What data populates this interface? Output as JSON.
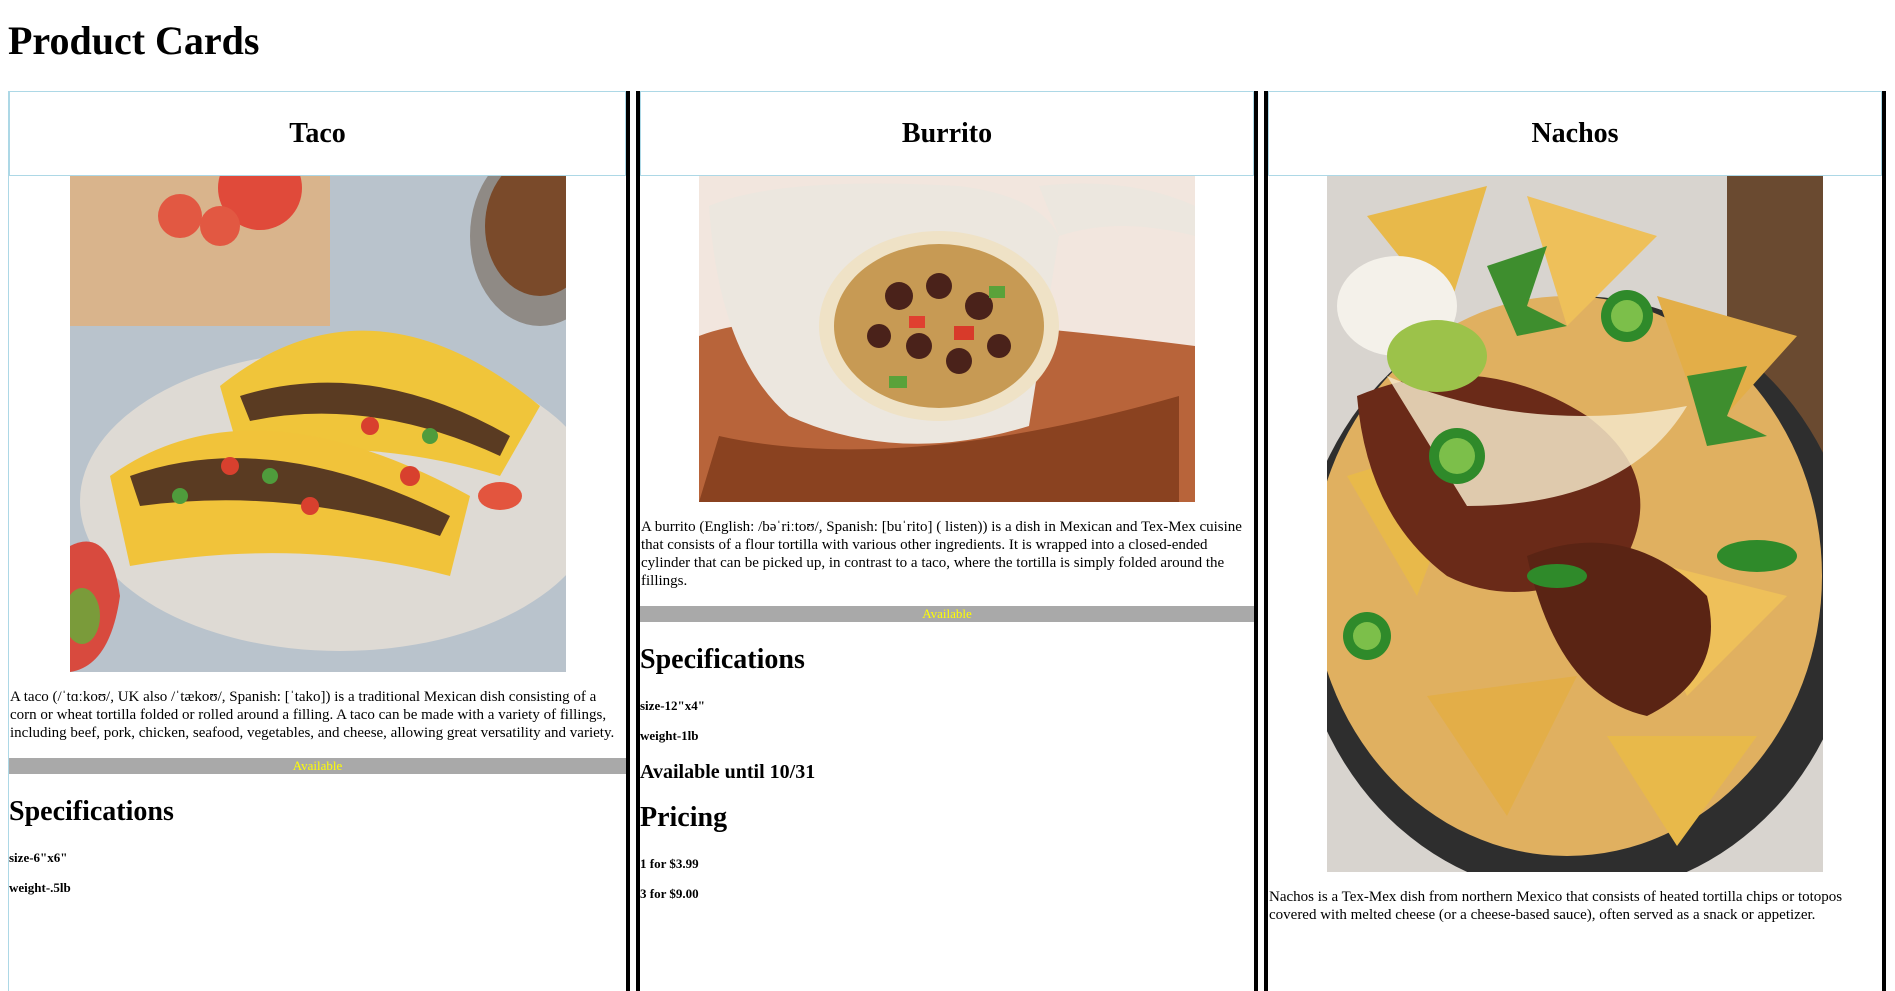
{
  "page": {
    "title": "Product Cards"
  },
  "colors": {
    "avail_bg": "#a9a9a9",
    "avail_text": "#ffff00",
    "card_border": "#add8e6"
  },
  "cards": [
    {
      "name": "Taco",
      "image": "taco-photo",
      "description": "A taco (/ˈtɑːkoʊ/, UK also /ˈtækoʊ/, Spanish: [ˈtako]) is a traditional Mexican dish consisting of a corn or wheat tortilla folded or rolled around a filling. A taco can be made with a variety of fillings, including beef, pork, chicken, seafood, vegetables, and cheese, allowing great versatility and variety.",
      "availability": "Available",
      "spec_title": "Specifications",
      "specs": [
        "size-6\"x6\"",
        "weight-.5lb"
      ]
    },
    {
      "name": "Burrito",
      "image": "burrito-photo",
      "description": "A burrito (English: /bəˈriːtoʊ/, Spanish: [buˈrito] ( listen)) is a dish in Mexican and Tex-Mex cuisine that consists of a flour tortilla with various other ingredients. It is wrapped into a closed-ended cylinder that can be picked up, in contrast to a taco, where the tortilla is simply folded around the fillings.",
      "availability": "Available",
      "spec_title": "Specifications",
      "specs": [
        "size-12\"x4\"",
        "weight-1lb"
      ],
      "available_until": "Available until 10/31",
      "pricing_title": "Pricing",
      "pricing": [
        "1 for $3.99",
        "3 for $9.00"
      ]
    },
    {
      "name": "Nachos",
      "image": "nachos-photo",
      "description": "Nachos is a Tex-Mex dish from northern Mexico that consists of heated tortilla chips or totopos covered with melted cheese (or a cheese-based sauce), often served as a snack or appetizer."
    }
  ]
}
